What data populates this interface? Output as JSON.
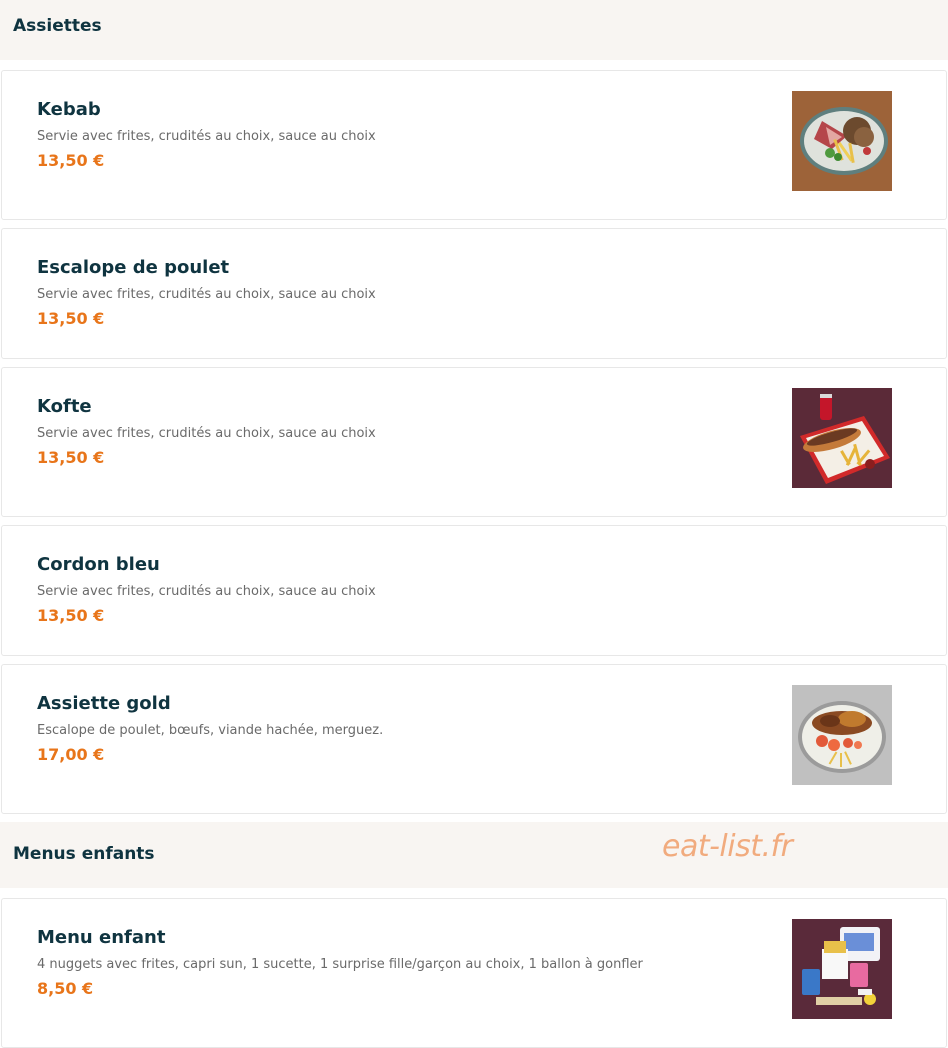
{
  "sections": {
    "assiettes": {
      "title": "Assiettes"
    },
    "menus_enfants": {
      "title": "Menus enfants"
    }
  },
  "items": [
    {
      "name": "Kebab",
      "description": "Servie avec frites, crudités au choix, sauce au choix",
      "price": "13,50 €",
      "image": "kebab-plate-photo"
    },
    {
      "name": "Escalope de poulet",
      "description": "Servie avec frites, crudités au choix, sauce au choix",
      "price": "13,50 €"
    },
    {
      "name": "Kofte",
      "description": "Servie avec frites, crudités au choix, sauce au choix",
      "price": "13,50 €",
      "image": "kofte-sandwich-tray-photo"
    },
    {
      "name": "Cordon bleu",
      "description": "Servie avec frites, crudités au choix, sauce au choix",
      "price": "13,50 €"
    },
    {
      "name": "Assiette gold",
      "description": "Escalope de poulet, bœufs, viande hachée, merguez.",
      "price": "17,00 €",
      "image": "assiette-gold-photo"
    },
    {
      "name": "Menu enfant",
      "description": "4 nuggets avec frites, capri sun, 1 sucette, 1 surprise fille/garçon au choix, 1 ballon à gonfler",
      "price": "8,50 €",
      "image": "kids-menu-box-photo"
    }
  ],
  "watermark": "eat-list.fr",
  "colors": {
    "section_bg": "#f8f5f2",
    "title": "#0f3440",
    "price": "#e8751a",
    "description": "#6a6a6a",
    "border": "#e7e7e7",
    "watermark": "#f1ab7e"
  }
}
